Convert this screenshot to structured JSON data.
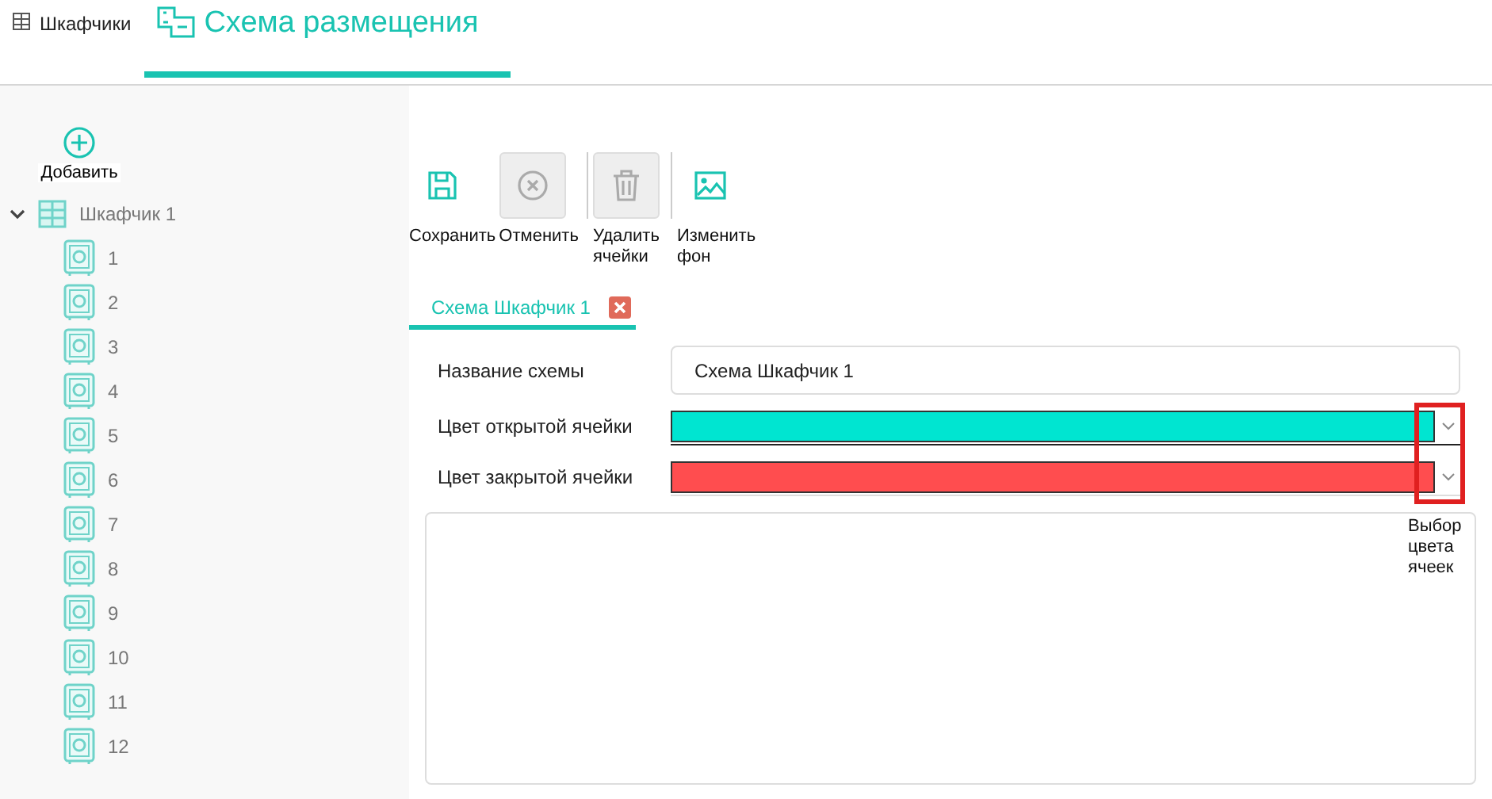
{
  "top_tabs": [
    {
      "label": "Шкафчики",
      "selected": false
    },
    {
      "label": "Схема размещения",
      "selected": true
    }
  ],
  "sidebar": {
    "add_button": "Добавить",
    "tree": [
      {
        "label": "Шкафчик 1",
        "expanded": true,
        "children": [
          {
            "label": "1"
          },
          {
            "label": "2"
          },
          {
            "label": "3"
          },
          {
            "label": "4"
          },
          {
            "label": "5"
          },
          {
            "label": "6"
          },
          {
            "label": "7"
          },
          {
            "label": "8"
          },
          {
            "label": "9"
          },
          {
            "label": "10"
          },
          {
            "label": "11"
          },
          {
            "label": "12"
          }
        ]
      }
    ]
  },
  "toolbar": [
    {
      "label": "Сохранить",
      "disabled": false
    },
    {
      "label": "Отменить",
      "disabled": true
    },
    {
      "label": "Удалить ячейки",
      "disabled": true
    },
    {
      "label": "Изменить фон",
      "disabled": false
    }
  ],
  "editor_tabs": [
    {
      "label": "Схема Шкафчик 1",
      "selected": true
    }
  ],
  "form": {
    "name_label": "Название схемы",
    "name_value": "Схема Шкафчик 1",
    "colors": [
      {
        "label": "Цвет открытой ячейки",
        "color": "#00e5d1"
      },
      {
        "label": "Цвет закрытой ячейки",
        "color": "#ff4d4f"
      }
    ]
  },
  "annotation": "Выбор цвета ячеек"
}
